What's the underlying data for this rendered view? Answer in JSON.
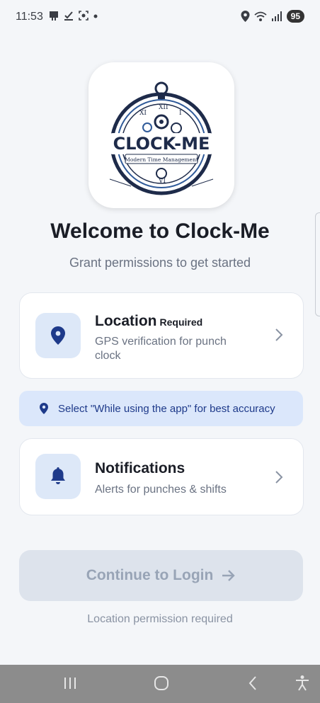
{
  "status_bar": {
    "time": "11:53",
    "battery": "95"
  },
  "logo": {
    "brand_text": "CLOCK-ME",
    "tagline": "Modern Time Management"
  },
  "welcome": {
    "title": "Welcome to Clock-Me",
    "subtitle": "Grant permissions to get started"
  },
  "permissions": [
    {
      "title": "Location",
      "badge": "Required",
      "description": "GPS verification for punch clock",
      "icon": "location-pin-icon"
    },
    {
      "title": "Notifications",
      "description": "Alerts for punches & shifts",
      "icon": "bell-icon"
    }
  ],
  "tip": {
    "text": "Select \"While using the app\" for best accuracy"
  },
  "continue_button": {
    "label": "Continue to Login"
  },
  "hint": "Location permission required",
  "colors": {
    "accent": "#1e3a8a",
    "icon_bg": "#dde8f8",
    "tip_bg": "#dbe7fb",
    "disabled_button": "#dde3ec"
  }
}
